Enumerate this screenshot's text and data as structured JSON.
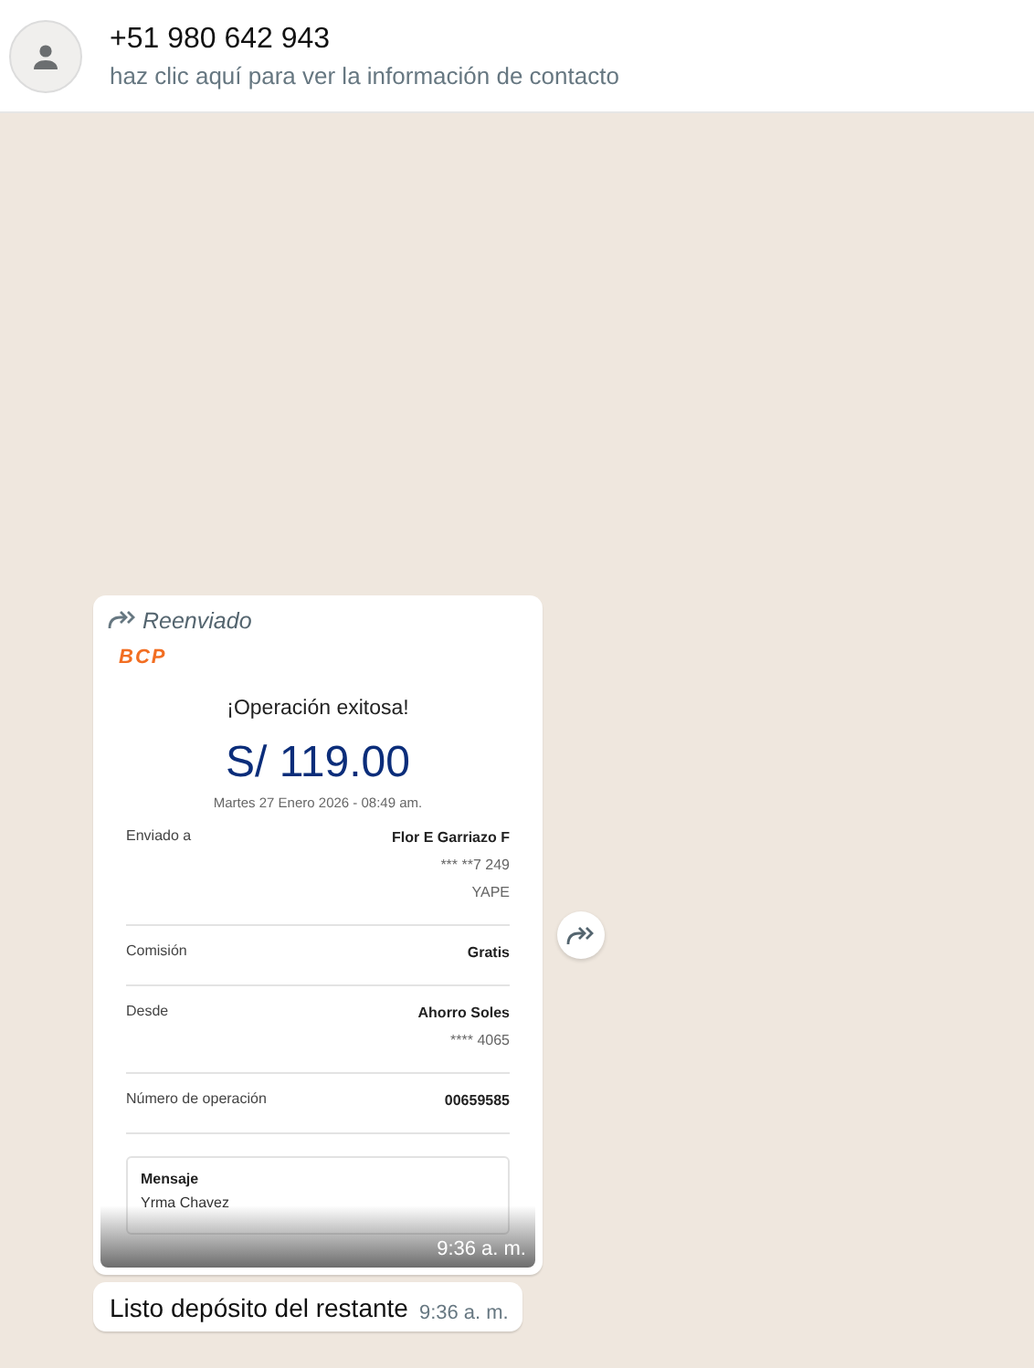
{
  "header": {
    "title": "+51 980 642 943",
    "subtitle": "haz clic aquí para ver la información de contacto"
  },
  "messages": [
    {
      "kind": "image",
      "forwarded": true,
      "forward_label": "Reenviado",
      "time": "9:36 a. m.",
      "receipt": {
        "logo": "BCP",
        "heading": "¡Operación exitosa!",
        "amount": "S/ 119.00",
        "date": "Martes 27 Enero 2026 - 08:49 am.",
        "rows": [
          {
            "label": "Enviado a",
            "values": [
              "Flor E Garriazo F",
              "*** **7 249",
              "YAPE"
            ]
          },
          {
            "label": "Comisión",
            "values": [
              "Gratis"
            ]
          },
          {
            "label": "Desde",
            "values": [
              "Ahorro Soles",
              "**** 4065"
            ]
          },
          {
            "label": "Número de operación",
            "values": [
              "00659585"
            ]
          }
        ],
        "note": {
          "title": "Mensaje",
          "text": "Yrma Chavez"
        }
      }
    },
    {
      "kind": "text",
      "forwarded": false,
      "text": "Listo depósito del restante",
      "time": "9:36 a. m."
    }
  ]
}
